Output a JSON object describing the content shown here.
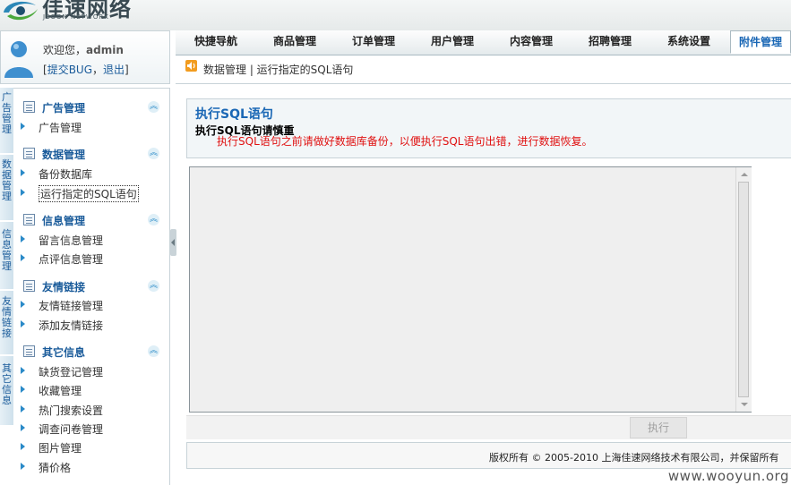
{
  "header": {
    "logo_title": "佳速网络",
    "logo_sub": "JSOON NETWORK"
  },
  "user": {
    "welcome": "欢迎您，",
    "name": "admin",
    "link_bracket_open": "[",
    "report_bug": "提交BUG",
    "separator": "，",
    "logout": "退出",
    "link_bracket_close": "]"
  },
  "nav": {
    "tabs": [
      {
        "label": "快捷导航"
      },
      {
        "label": "商品管理"
      },
      {
        "label": "订单管理"
      },
      {
        "label": "用户管理"
      },
      {
        "label": "内容管理"
      },
      {
        "label": "招聘管理"
      },
      {
        "label": "系统设置"
      },
      {
        "label": "附件管理"
      }
    ],
    "active_index": 7
  },
  "breadcrumb": {
    "text": "数据管理 | 运行指定的SQL语句"
  },
  "sidetabs": [
    {
      "label": "广告管理"
    },
    {
      "label": "数据管理"
    },
    {
      "label": "信息管理"
    },
    {
      "label": "友情链接"
    },
    {
      "label": "其它信息"
    }
  ],
  "sidebar": {
    "sections": [
      {
        "title": "广告管理",
        "items": [
          {
            "label": "广告管理"
          }
        ]
      },
      {
        "title": "数据管理",
        "items": [
          {
            "label": "备份数据库"
          },
          {
            "label": "运行指定的SQL语句"
          }
        ]
      },
      {
        "title": "信息管理",
        "items": [
          {
            "label": "留言信息管理"
          },
          {
            "label": "点评信息管理"
          }
        ]
      },
      {
        "title": "友情链接",
        "items": [
          {
            "label": "友情链接管理"
          },
          {
            "label": "添加友情链接"
          }
        ]
      },
      {
        "title": "其它信息",
        "items": [
          {
            "label": "缺货登记管理"
          },
          {
            "label": "收藏管理"
          },
          {
            "label": "热门搜索设置"
          },
          {
            "label": "调查问卷管理"
          },
          {
            "label": "图片管理"
          },
          {
            "label": "猜价格"
          }
        ]
      }
    ],
    "collapse_glyph": "︽"
  },
  "main": {
    "title": "执行SQL语句",
    "subtitle": "执行SQL语句请慎重",
    "warning": "执行SQL语句之前请做好数据库备份，以便执行SQL语句出错，进行数据恢复。",
    "sql_value": "",
    "execute_label": "执行",
    "footer": "版权所有 © 2005-2010 上海佳速网络技术有限公司，并保留所有"
  },
  "watermark": "www.wooyun.org",
  "colors": {
    "accent": "#1a67b5",
    "warning": "#e01010"
  }
}
